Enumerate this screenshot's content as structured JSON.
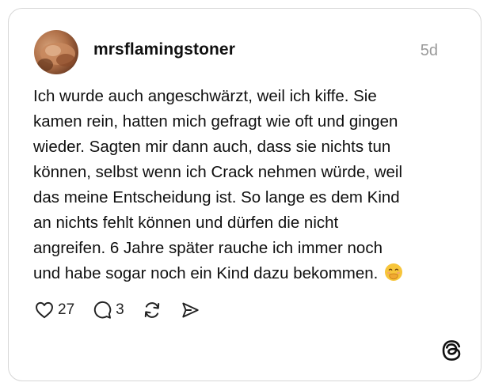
{
  "post": {
    "username": "mrsflamingstoner",
    "timestamp": "5d",
    "text_lines": [
      "Ich wurde auch angeschwärzt, weil ich kiffe. Sie",
      "kamen rein, hatten mich gefragt wie oft und gingen",
      "wieder. Sagten mir dann auch, dass sie nichts tun",
      "können, selbst wenn ich Crack nehmen würde, weil",
      "das meine Entscheidung ist. So lange es dem Kind",
      "an nichts fehlt können und dürfen die nicht",
      "angreifen. 6 Jahre später rauche ich immer noch",
      "und habe sogar noch ein Kind dazu bekommen."
    ],
    "emoji_icon": "face-with-hand-over-mouth-emoji"
  },
  "actions": {
    "likes": "27",
    "replies": "3",
    "icons": [
      "heart-icon",
      "comment-icon",
      "repost-icon",
      "share-icon"
    ]
  },
  "branding": {
    "logo": "threads-logo-icon"
  },
  "colors": {
    "text": "#101010",
    "muted": "#9a9a9a",
    "border": "#d6d6d6",
    "emoji": "#f7c53a"
  }
}
